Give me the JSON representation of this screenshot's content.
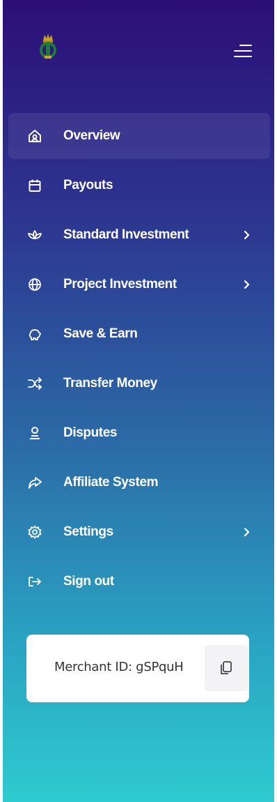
{
  "sidebar": {
    "logo_icon": "crown-emblem-logo",
    "menu_toggle_icon": "hamburger-menu-icon",
    "items": [
      {
        "label": "Overview",
        "icon": "home-icon",
        "active": true
      },
      {
        "label": "Payouts",
        "icon": "calendar-icon"
      },
      {
        "label": "Standard Investment",
        "icon": "lotus-icon",
        "has_submenu": true
      },
      {
        "label": "Project Investment",
        "icon": "globe-icon",
        "has_submenu": true
      },
      {
        "label": "Save & Earn",
        "icon": "piggy-bank-icon"
      },
      {
        "label": "Transfer Money",
        "icon": "shuffle-icon"
      },
      {
        "label": "Disputes",
        "icon": "user-support-icon"
      },
      {
        "label": "Affiliate System",
        "icon": "share-arrow-icon"
      },
      {
        "label": "Settings",
        "icon": "gear-icon",
        "has_submenu": true
      },
      {
        "label": "Sign out",
        "icon": "sign-out-icon"
      }
    ]
  },
  "merchant": {
    "id_text": "Merchant ID: gSPquH",
    "copy_icon": "copy-icon"
  },
  "colors": {
    "gradient_top": "#2c0f78",
    "gradient_bottom": "#2ecbd0",
    "logo_gold": "#c9a227",
    "logo_green": "#1f7a3a"
  }
}
